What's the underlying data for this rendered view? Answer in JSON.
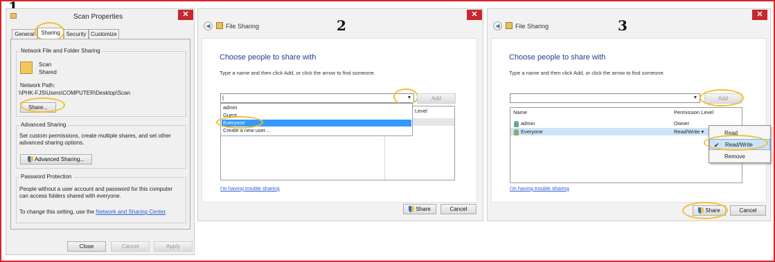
{
  "steps": {
    "one": "1",
    "two": "2",
    "three": "3"
  },
  "colors": {
    "frame": "#d9212a",
    "highlight": "#f0c030",
    "link": "#2a5bd7",
    "heading": "#1e3e8c",
    "selection": "#3399ff"
  },
  "props": {
    "title": "Scan Properties",
    "close_glyph": "✕",
    "tabs": [
      "General",
      "Sharing",
      "Security",
      "Customize"
    ],
    "network_group": "Network File and Folder Sharing",
    "folder_name": "Scan",
    "folder_state": "Shared",
    "network_path_label": "Network Path:",
    "network_path": "\\\\PHK-FJS\\Users\\COMPUTER\\Desktop\\Scan",
    "share_btn": "Share...",
    "advanced_group": "Advanced Sharing",
    "advanced_desc": "Set custom permissions, create multiple shares, and set other advanced sharing options.",
    "advanced_btn": "Advanced Sharing...",
    "password_group": "Password Protection",
    "password_desc": "People without a user account and password for this computer can access folders shared with everyone.",
    "password_change_prefix": "To change this setting, use the ",
    "password_link": "Network and Sharing Center",
    "password_change_suffix": ".",
    "close_btn": "Close",
    "cancel_btn": "Cancel",
    "apply_btn": "Apply"
  },
  "fs2": {
    "title": "File Sharing",
    "heading": "Choose people to share with",
    "instruction": "Type a name and then click Add, or click the arrow to find someone.",
    "input_value": "|",
    "add_btn": "Add",
    "dropdown": [
      "admin",
      "Guest",
      "Everyone",
      "Create a new user..."
    ],
    "col_level": "Level",
    "trouble_link": "I'm having trouble sharing",
    "share_btn": "Share",
    "cancel_btn": "Cancel"
  },
  "fs3": {
    "title": "File Sharing",
    "heading": "Choose people to share with",
    "instruction": "Type a name and then click Add, or click the arrow to find someone.",
    "add_btn": "Add",
    "col_name": "Name",
    "col_perm": "Permission Level",
    "rows": [
      {
        "name": "admin",
        "perm": "Owner"
      },
      {
        "name": "Everyone",
        "perm": "Read/Write ▾"
      }
    ],
    "menu": [
      "Read",
      "Read/Write",
      "Remove"
    ],
    "check": "✔",
    "trouble_link": "I'm having trouble sharing",
    "share_btn": "Share",
    "cancel_btn": "Cancel"
  }
}
